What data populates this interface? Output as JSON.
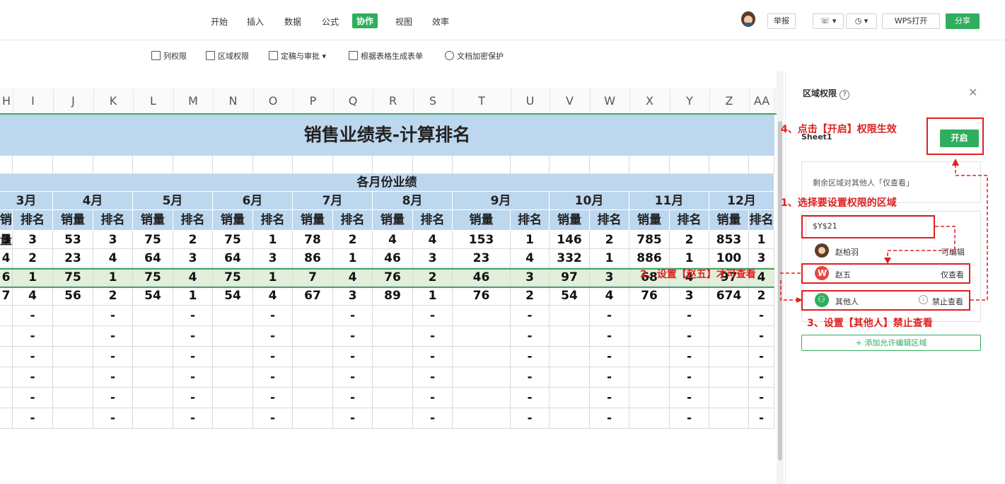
{
  "menu": {
    "items": [
      {
        "label": "开始"
      },
      {
        "label": "插入"
      },
      {
        "label": "数据"
      },
      {
        "label": "公式"
      },
      {
        "label": "协作"
      },
      {
        "label": "视图"
      },
      {
        "label": "效率"
      }
    ],
    "active_label": "协作",
    "report": "举报",
    "wps_open": "WPS打开",
    "share": "分享"
  },
  "toolbar": {
    "col_permission": "列权限",
    "area_permission": "区域权限",
    "finalize": "定稿与审批",
    "gen_form": "根据表格生成表单",
    "encrypt": "文档加密保护"
  },
  "sheet": {
    "col_letters": [
      "H",
      "I",
      "J",
      "K",
      "L",
      "M",
      "N",
      "O",
      "P",
      "Q",
      "R",
      "S",
      "T",
      "U",
      "V",
      "W",
      "X",
      "Y",
      "Z",
      "AA"
    ],
    "title": "销售业绩表-计算排名",
    "section_header": "各月份业绩",
    "months": [
      "3月",
      "4月",
      "5月",
      "6月",
      "7月",
      "8月",
      "9月",
      "10月",
      "11月",
      "12月"
    ],
    "sub_sales": "销量",
    "sub_rank": "排名",
    "rows": [
      [
        "3",
        "3",
        "53",
        "3",
        "75",
        "2",
        "75",
        "1",
        "78",
        "2",
        "4",
        "4",
        "153",
        "1",
        "146",
        "2",
        "785",
        "2",
        "853",
        "1"
      ],
      [
        "4",
        "2",
        "23",
        "4",
        "64",
        "3",
        "64",
        "3",
        "86",
        "1",
        "46",
        "3",
        "23",
        "4",
        "332",
        "1",
        "886",
        "1",
        "100",
        "3"
      ],
      [
        "6",
        "1",
        "75",
        "1",
        "75",
        "4",
        "75",
        "1",
        "7",
        "4",
        "76",
        "2",
        "46",
        "3",
        "97",
        "3",
        "68",
        "4",
        "97",
        "4"
      ],
      [
        "7",
        "4",
        "56",
        "2",
        "54",
        "1",
        "54",
        "4",
        "67",
        "3",
        "89",
        "1",
        "76",
        "2",
        "54",
        "4",
        "76",
        "3",
        "674",
        "2"
      ]
    ],
    "empty_mark": "-"
  },
  "panel": {
    "title": "区域权限",
    "help_icon": "?",
    "sheet_name": "Sheet1",
    "open_button": "开启",
    "remaining_text": "剩余区域对其他人「仅查看」",
    "range_value": "$Y$21",
    "users": [
      {
        "name": "赵柏羽",
        "permission": "可编辑"
      },
      {
        "name": "赵五",
        "permission": "仅查看"
      },
      {
        "name": "其他人",
        "permission": "禁止查看"
      }
    ],
    "add_area": "+ 添加允许编辑区域"
  },
  "annotations": {
    "step1": "1、选择要设置权限的区域",
    "step2": "2、设置【赵五】才可查看",
    "step3": "3、设置【其他人】禁止查看",
    "step4": "4、点击【开启】权限生效"
  },
  "colors": {
    "green": "#2fae5d",
    "header_blue": "#bdd7ee",
    "row_green": "#e2efda",
    "annotation_red": "#e02020"
  }
}
